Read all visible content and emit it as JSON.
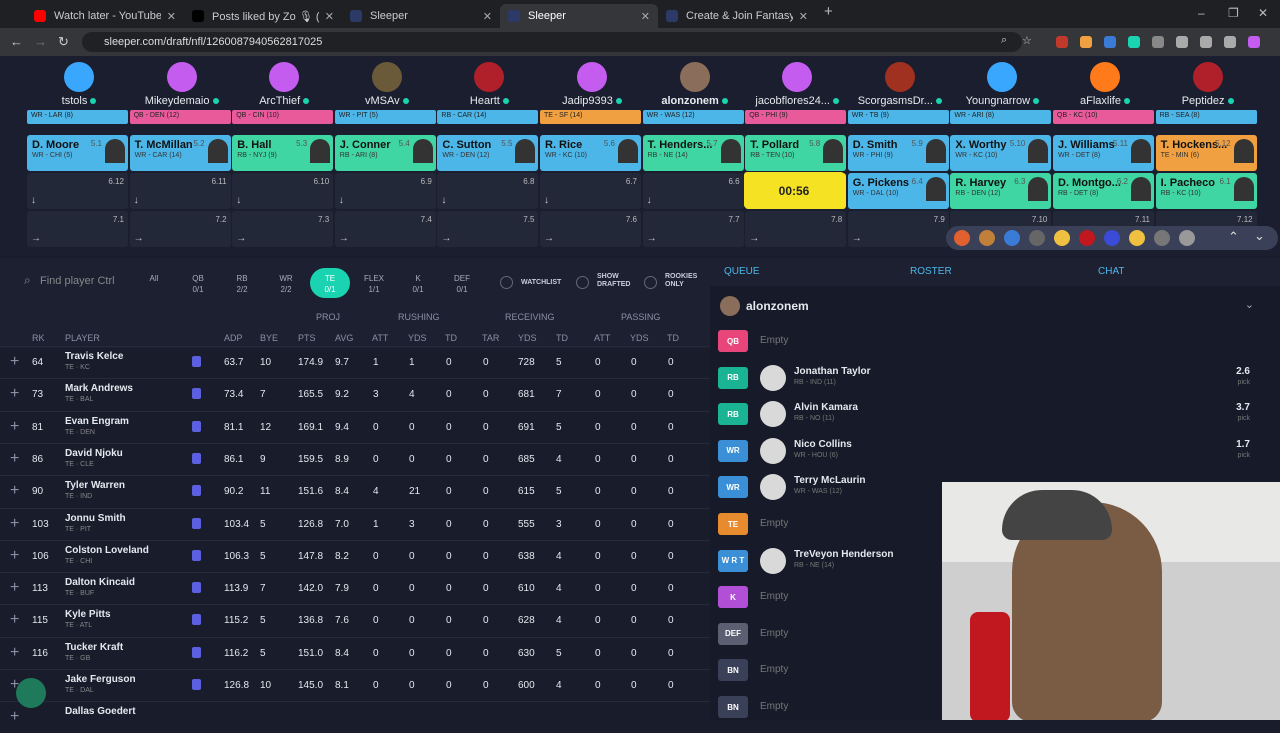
{
  "browser": {
    "tabs": [
      {
        "title": "Watch later - YouTube",
        "icon": "youtube-icon",
        "color": "#ff0000",
        "active": false
      },
      {
        "title": "Posts liked by Zo 🎙 (@alonzo",
        "icon": "x-icon",
        "color": "#000000",
        "active": false
      },
      {
        "title": "Sleeper",
        "icon": "sleeper-icon",
        "color": "#2b3a67",
        "active": false
      },
      {
        "title": "Sleeper",
        "icon": "sleeper-icon",
        "color": "#2b3a67",
        "active": true
      },
      {
        "title": "Create & Join Fantasy Football",
        "icon": "sleeper-icon",
        "color": "#2b3a67",
        "active": false
      }
    ],
    "new_tab": "+",
    "url": "sleeper.com/draft/nfl/1260087940562817025",
    "window_controls": {
      "minimize": "–",
      "maximize": "❐",
      "close": "✕"
    }
  },
  "teams": [
    {
      "name": "tstols",
      "avatar_color": "#3aa7ff"
    },
    {
      "name": "Mikeydemaio",
      "avatar_color": "#c45cf0"
    },
    {
      "name": "ArcThief",
      "avatar_color": "#c45cf0"
    },
    {
      "name": "vMSAv",
      "avatar_color": "#6b5a3a"
    },
    {
      "name": "Heartt",
      "avatar_color": "#b0202a"
    },
    {
      "name": "Jadip9393",
      "avatar_color": "#c45cf0"
    },
    {
      "name": "alonzonem",
      "avatar_color": "#8a6d5a",
      "me": true
    },
    {
      "name": "jacobflores24...",
      "avatar_color": "#c45cf0"
    },
    {
      "name": "ScorgasmsDr...",
      "avatar_color": "#a03020"
    },
    {
      "name": "Youngnarrow",
      "avatar_color": "#3aa7ff"
    },
    {
      "name": "aFlaxlife",
      "avatar_color": "#ff7a1a"
    },
    {
      "name": "Peptidez",
      "avatar_color": "#b0202a"
    }
  ],
  "round1_strip": [
    {
      "text": "WR - LAR (8)",
      "color": "#4db6e8"
    },
    {
      "text": "QB - DEN (12)",
      "color": "#e85a9a"
    },
    {
      "text": "QB - CIN (10)",
      "color": "#e85a9a"
    },
    {
      "text": "WR - PIT (5)",
      "color": "#4db6e8"
    },
    {
      "text": "RB - CAR (14)",
      "color": "#4db6e8"
    },
    {
      "text": "TE - SF (14)",
      "color": "#f0a040"
    },
    {
      "text": "WR - WAS (12)",
      "color": "#4db6e8"
    },
    {
      "text": "QB - PHI (9)",
      "color": "#e85a9a"
    },
    {
      "text": "WR - TB (9)",
      "color": "#4db6e8"
    },
    {
      "text": "WR - ARI (8)",
      "color": "#4db6e8"
    },
    {
      "text": "QB - KC (10)",
      "color": "#e85a9a"
    },
    {
      "text": "RB - SEA (8)",
      "color": "#4db6e8"
    }
  ],
  "round5": [
    {
      "player": "D. Moore",
      "info": "WR - CHI (5)",
      "pick": "5.1",
      "color": "#4db6e8"
    },
    {
      "player": "T. McMillan",
      "info": "WR - CAR (14)",
      "pick": "5.2",
      "color": "#4db6e8"
    },
    {
      "player": "B. Hall",
      "info": "RB - NYJ (9)",
      "pick": "5.3",
      "color": "#3fd6a4"
    },
    {
      "player": "J. Conner",
      "info": "RB - ARI (8)",
      "pick": "5.4",
      "color": "#3fd6a4"
    },
    {
      "player": "C. Sutton",
      "info": "WR - DEN (12)",
      "pick": "5.5",
      "color": "#4db6e8"
    },
    {
      "player": "R. Rice",
      "info": "WR - KC (10)",
      "pick": "5.6",
      "color": "#4db6e8"
    },
    {
      "player": "T. Henders...",
      "info": "RB - NE (14)",
      "pick": "5.7",
      "color": "#3fd6a4"
    },
    {
      "player": "T. Pollard",
      "info": "RB - TEN (10)",
      "pick": "5.8",
      "color": "#3fd6a4"
    },
    {
      "player": "D. Smith",
      "info": "WR - PHI (9)",
      "pick": "5.9",
      "color": "#4db6e8"
    },
    {
      "player": "X. Worthy",
      "info": "WR - KC (10)",
      "pick": "5.10",
      "color": "#4db6e8"
    },
    {
      "player": "J. Williams",
      "info": "WR - DET (8)",
      "pick": "5.11",
      "color": "#4db6e8"
    },
    {
      "player": "T. Hockens...",
      "info": "TE - MIN (6)",
      "pick": "5.12",
      "color": "#f0a040"
    }
  ],
  "round6": [
    {
      "pick": "6.12"
    },
    {
      "pick": "6.11"
    },
    {
      "pick": "6.10"
    },
    {
      "pick": "6.9"
    },
    {
      "pick": "6.8"
    },
    {
      "pick": "6.7"
    },
    {
      "pick": "6.6"
    },
    {
      "pick": "6.5",
      "timer": "00:56"
    },
    {
      "player": "G. Pickens",
      "info": "WR - DAL (10)",
      "pick": "6.4",
      "color": "#4db6e8"
    },
    {
      "player": "R. Harvey",
      "info": "RB - DEN (12)",
      "pick": "6.3",
      "color": "#3fd6a4"
    },
    {
      "player": "D. Montgo...",
      "info": "RB - DET (8)",
      "pick": "6.2",
      "color": "#3fd6a4"
    },
    {
      "player": "I. Pacheco",
      "info": "RB - KC (10)",
      "pick": "6.1",
      "color": "#3fd6a4"
    }
  ],
  "round7": [
    "7.1",
    "7.2",
    "7.3",
    "7.4",
    "7.5",
    "7.6",
    "7.7",
    "7.8",
    "7.9",
    "7.10",
    "7.11",
    "7.12"
  ],
  "filters": {
    "search_placeholder": "Find player Ctrl",
    "positions": [
      {
        "label": "All",
        "count": ""
      },
      {
        "label": "QB",
        "count": "0/1"
      },
      {
        "label": "RB",
        "count": "2/2"
      },
      {
        "label": "WR",
        "count": "2/2"
      },
      {
        "label": "TE",
        "count": "0/1",
        "active": true
      },
      {
        "label": "FLEX",
        "count": "1/1"
      },
      {
        "label": "K",
        "count": "0/1"
      },
      {
        "label": "DEF",
        "count": "0/1"
      }
    ],
    "watchlist": "WATCHLIST",
    "show_drafted": [
      "SHOW",
      "DRAFTED"
    ],
    "rookies_only": [
      "ROOKIES",
      "ONLY"
    ]
  },
  "table": {
    "groups": [
      "PROJ",
      "RUSHING",
      "RECEIVING",
      "PASSING"
    ],
    "columns": [
      "RK",
      "PLAYER",
      "ADP",
      "BYE",
      "PTS",
      "AVG",
      "ATT",
      "YDS",
      "TD",
      "TAR",
      "YDS",
      "TD",
      "ATT",
      "YDS",
      "TD"
    ],
    "rows": [
      {
        "rk": "64",
        "name": "Travis Kelce",
        "sub": "TE · KC",
        "adp": "63.7",
        "bye": "10",
        "pts": "174.9",
        "avg": "9.7",
        "ratt": "1",
        "ryds": "1",
        "rtd": "0",
        "tar": "0",
        "cyds": "728",
        "ctd": "5",
        "patt": "0",
        "pyds": "0",
        "ptd": "0"
      },
      {
        "rk": "73",
        "name": "Mark Andrews",
        "sub": "TE · BAL",
        "adp": "73.4",
        "bye": "7",
        "pts": "165.5",
        "avg": "9.2",
        "ratt": "3",
        "ryds": "4",
        "rtd": "0",
        "tar": "0",
        "cyds": "681",
        "ctd": "7",
        "patt": "0",
        "pyds": "0",
        "ptd": "0"
      },
      {
        "rk": "81",
        "name": "Evan Engram",
        "sub": "TE · DEN",
        "adp": "81.1",
        "bye": "12",
        "pts": "169.1",
        "avg": "9.4",
        "ratt": "0",
        "ryds": "0",
        "rtd": "0",
        "tar": "0",
        "cyds": "691",
        "ctd": "5",
        "patt": "0",
        "pyds": "0",
        "ptd": "0"
      },
      {
        "rk": "86",
        "name": "David Njoku",
        "sub": "TE · CLE",
        "adp": "86.1",
        "bye": "9",
        "pts": "159.5",
        "avg": "8.9",
        "ratt": "0",
        "ryds": "0",
        "rtd": "0",
        "tar": "0",
        "cyds": "685",
        "ctd": "4",
        "patt": "0",
        "pyds": "0",
        "ptd": "0"
      },
      {
        "rk": "90",
        "name": "Tyler Warren",
        "sub": "TE · IND",
        "adp": "90.2",
        "bye": "11",
        "pts": "151.6",
        "avg": "8.4",
        "ratt": "4",
        "ryds": "21",
        "rtd": "0",
        "tar": "0",
        "cyds": "615",
        "ctd": "5",
        "patt": "0",
        "pyds": "0",
        "ptd": "0"
      },
      {
        "rk": "103",
        "name": "Jonnu Smith",
        "sub": "TE · PIT",
        "adp": "103.4",
        "bye": "5",
        "pts": "126.8",
        "avg": "7.0",
        "ratt": "1",
        "ryds": "3",
        "rtd": "0",
        "tar": "0",
        "cyds": "555",
        "ctd": "3",
        "patt": "0",
        "pyds": "0",
        "ptd": "0"
      },
      {
        "rk": "106",
        "name": "Colston Loveland",
        "sub": "TE · CHI",
        "adp": "106.3",
        "bye": "5",
        "pts": "147.8",
        "avg": "8.2",
        "ratt": "0",
        "ryds": "0",
        "rtd": "0",
        "tar": "0",
        "cyds": "638",
        "ctd": "4",
        "patt": "0",
        "pyds": "0",
        "ptd": "0"
      },
      {
        "rk": "113",
        "name": "Dalton Kincaid",
        "sub": "TE · BUF",
        "adp": "113.9",
        "bye": "7",
        "pts": "142.0",
        "avg": "7.9",
        "ratt": "0",
        "ryds": "0",
        "rtd": "0",
        "tar": "0",
        "cyds": "610",
        "ctd": "4",
        "patt": "0",
        "pyds": "0",
        "ptd": "0"
      },
      {
        "rk": "115",
        "name": "Kyle Pitts",
        "sub": "TE · ATL",
        "adp": "115.2",
        "bye": "5",
        "pts": "136.8",
        "avg": "7.6",
        "ratt": "0",
        "ryds": "0",
        "rtd": "0",
        "tar": "0",
        "cyds": "628",
        "ctd": "4",
        "patt": "0",
        "pyds": "0",
        "ptd": "0"
      },
      {
        "rk": "116",
        "name": "Tucker Kraft",
        "sub": "TE · GB",
        "adp": "116.2",
        "bye": "5",
        "pts": "151.0",
        "avg": "8.4",
        "ratt": "0",
        "ryds": "0",
        "rtd": "0",
        "tar": "0",
        "cyds": "630",
        "ctd": "5",
        "patt": "0",
        "pyds": "0",
        "ptd": "0"
      },
      {
        "rk": "",
        "name": "Jake Ferguson",
        "sub": "TE · DAL",
        "adp": "126.8",
        "bye": "10",
        "pts": "145.0",
        "avg": "8.1",
        "ratt": "0",
        "ryds": "0",
        "rtd": "0",
        "tar": "0",
        "cyds": "600",
        "ctd": "4",
        "patt": "0",
        "pyds": "0",
        "ptd": "0"
      },
      {
        "rk": "",
        "name": "Dallas Goedert",
        "sub": "",
        "adp": "",
        "bye": "",
        "pts": "",
        "avg": "",
        "ratt": "",
        "ryds": "",
        "rtd": "",
        "tar": "",
        "cyds": "",
        "ctd": "",
        "patt": "",
        "pyds": "",
        "ptd": ""
      }
    ]
  },
  "right_panel": {
    "tabs": [
      "QUEUE",
      "ROSTER",
      "CHAT"
    ],
    "owner": "alonzonem",
    "slots": [
      {
        "pos": "QB",
        "color": "#e8457a",
        "player": "",
        "sub": "",
        "empty": "Empty",
        "pick": ""
      },
      {
        "pos": "RB",
        "color": "#1ab394",
        "player": "Jonathan Taylor",
        "sub": "RB - IND (11)",
        "empty": "",
        "pick": "2.6"
      },
      {
        "pos": "RB",
        "color": "#1ab394",
        "player": "Alvin Kamara",
        "sub": "RB - NO (11)",
        "empty": "",
        "pick": "3.7"
      },
      {
        "pos": "WR",
        "color": "#3a8fd6",
        "player": "Nico Collins",
        "sub": "WR - HOU (6)",
        "empty": "",
        "pick": "1.7"
      },
      {
        "pos": "WR",
        "color": "#3a8fd6",
        "player": "Terry McLaurin",
        "sub": "WR - WAS (12)",
        "empty": "",
        "pick": ""
      },
      {
        "pos": "TE",
        "color": "#e88a2e",
        "player": "",
        "sub": "",
        "empty": "Empty",
        "pick": ""
      },
      {
        "pos": "W R T",
        "color": "#3a8fd6",
        "player": "TreVeyon Henderson",
        "sub": "RB - NE (14)",
        "empty": "",
        "pick": ""
      },
      {
        "pos": "K",
        "color": "#b14fd6",
        "player": "",
        "sub": "",
        "empty": "Empty",
        "pick": ""
      },
      {
        "pos": "DEF",
        "color": "#5a6072",
        "player": "",
        "sub": "",
        "empty": "Empty",
        "pick": ""
      },
      {
        "pos": "BN",
        "color": "#3a4058",
        "player": "",
        "sub": "",
        "empty": "Empty",
        "pick": ""
      },
      {
        "pos": "BN",
        "color": "#3a4058",
        "player": "",
        "sub": "",
        "empty": "Empty",
        "pick": ""
      }
    ],
    "pick_unit": "pick"
  }
}
